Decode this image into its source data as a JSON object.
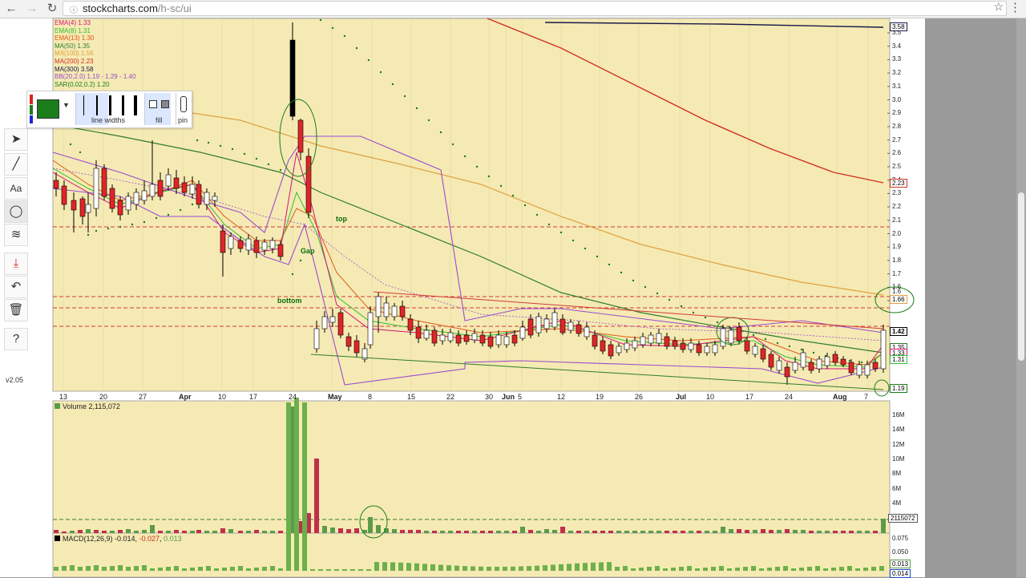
{
  "browser": {
    "url_host": "stockcharts.com",
    "url_path": "/h-sc/ui"
  },
  "tools": {
    "version": "v2.05",
    "style_labels": {
      "line_widths": "line widths",
      "fill": "fill",
      "pin": "pin"
    }
  },
  "legend": [
    {
      "text": "EMA(4) 1.33",
      "color": "#d4147c"
    },
    {
      "text": "EMA(8) 1.31",
      "color": "#30c030"
    },
    {
      "text": "EMA(13) 1.30",
      "color": "#e05a1a"
    },
    {
      "text": "MA(50) 1.35",
      "color": "#2e7d2e"
    },
    {
      "text": "MA(100) 1.56",
      "color": "#e0a040"
    },
    {
      "text": "MA(200) 2.23",
      "color": "#d03020"
    },
    {
      "text": "MA(300) 3.58",
      "color": "#1a1a4a"
    },
    {
      "text": "BB(20,2.0) 1.19 - 1.29 - 1.40",
      "color": "#9b4bd0"
    },
    {
      "text": "SAR(0.02,0.2) 1.20",
      "color": "#1a7d1a"
    }
  ],
  "chart_data": [
    {
      "type": "candlestick",
      "y_axis_ticks": [
        "3.5",
        "3.4",
        "3.3",
        "3.2",
        "3.1",
        "3.0",
        "2.9",
        "2.8",
        "2.7",
        "2.6",
        "2.5",
        "2.4",
        "2.3",
        "2.2",
        "2.1",
        "2.0",
        "1.9",
        "1.8",
        "1.7",
        "1.6",
        "1.5"
      ],
      "x_axis_ticks": [
        {
          "label": "13"
        },
        {
          "label": "20"
        },
        {
          "label": "27"
        },
        {
          "label": "Apr",
          "bold": true
        },
        {
          "label": "10"
        },
        {
          "label": "17"
        },
        {
          "label": "24"
        },
        {
          "label": "May",
          "bold": true
        },
        {
          "label": "8"
        },
        {
          "label": "15"
        },
        {
          "label": "22"
        },
        {
          "label": "30"
        },
        {
          "label": "Jun",
          "bold": true
        },
        {
          "label": "5"
        },
        {
          "label": "12"
        },
        {
          "label": "19"
        },
        {
          "label": "26"
        },
        {
          "label": "Jul",
          "bold": true
        },
        {
          "label": "10"
        },
        {
          "label": "17"
        },
        {
          "label": "24"
        },
        {
          "label": "Aug",
          "bold": true
        },
        {
          "label": "7"
        }
      ],
      "price_tags": [
        "3.58",
        "2.23",
        "1.66",
        "1.42",
        "1.35",
        "1.33",
        "1.31",
        "1.19"
      ],
      "extra_labels": [
        "1.6"
      ],
      "annotations": [
        "top",
        "Gap",
        "bottom"
      ]
    },
    {
      "type": "bar",
      "title": "Volume 2,115,072",
      "y_axis_ticks": [
        "16M",
        "14M",
        "12M",
        "10M",
        "8M",
        "6M",
        "4M"
      ],
      "last_value_tag": "2115072"
    },
    {
      "type": "bar",
      "title": "MACD(12,26,9) -0.014, -0.027, 0.013",
      "title_parts": [
        "MACD(12,26,9) -0.014, ",
        "-0.027",
        ", ",
        "0.013"
      ],
      "y_axis_ticks": [
        "0.075",
        "0.050",
        "0.025"
      ],
      "value_tags": [
        "0.013",
        "0.014"
      ]
    }
  ],
  "colors": {
    "chart_bg": "#f5eab3",
    "up_candle": "#ffffff",
    "down_candle": "#e0252a",
    "volume_up": "#5b9b4a",
    "volume_down": "#c0304a"
  }
}
